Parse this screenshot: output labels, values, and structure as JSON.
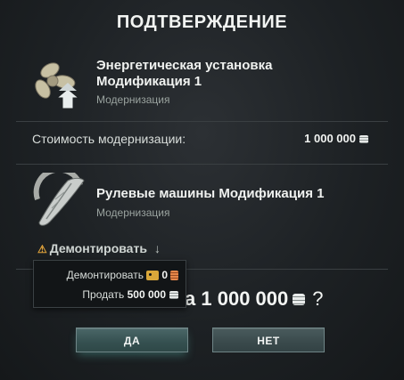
{
  "dialog": {
    "title": "ПОДТВЕРЖДЕНИЕ"
  },
  "new_module": {
    "name_line1": "Энергетическая установка",
    "name_line2": "Модификация 1",
    "type": "Модернизация",
    "icon": "propeller-upgrade-icon"
  },
  "cost": {
    "label": "Стоимость модернизации:",
    "value": "1 000 000",
    "currency_icon": "credits-icon"
  },
  "old_module": {
    "name": "Рулевые машины Модификация 1",
    "type": "Модернизация",
    "icon": "rudder-gear-icon"
  },
  "demount": {
    "warning_icon": "warning-icon",
    "label": "Демонтировать",
    "arrow_icon": "arrow-down-icon",
    "options": [
      {
        "label": "Демонтировать",
        "value": "0",
        "icon": "coupon-icon",
        "currency_icon": "bronze-icon"
      },
      {
        "label": "Продать",
        "value": "500 000",
        "currency_icon": "credits-icon"
      }
    ]
  },
  "total": {
    "partial_prefix": "а",
    "value": "1 000 000",
    "suffix": "?"
  },
  "buttons": {
    "yes": "ДА",
    "no": "НЕТ"
  },
  "colors": {
    "accent": "#4b6768",
    "warning": "#e0a23a",
    "coupon": "#d9a73a",
    "bronze": "#e6874a"
  }
}
